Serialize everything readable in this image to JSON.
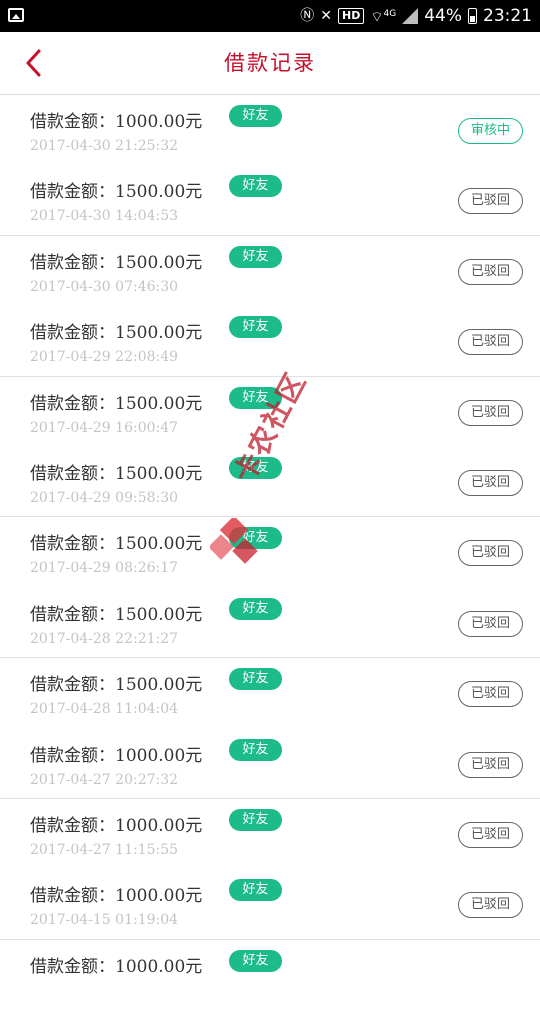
{
  "status_bar": {
    "battery": "44%",
    "time": "23:21",
    "hd_label": "HD",
    "network_label": "4G",
    "icons": [
      "gallery-icon",
      "nfc-icon",
      "mute-icon",
      "wifi-icon",
      "signal-icon",
      "battery-icon"
    ]
  },
  "header": {
    "title": "借款记录",
    "back_icon": "chevron-left-icon"
  },
  "colors": {
    "accent_red": "#c8102e",
    "tag_green": "#1dba8a",
    "time_gray": "#c4c4c4"
  },
  "records": [
    {
      "amount": "借款金额：1000.00元",
      "tag": "好友",
      "time": "2017-04-30 21:25:32",
      "status": "审核中",
      "status_type": "reviewing"
    },
    {
      "amount": "借款金额：1500.00元",
      "tag": "好友",
      "time": "2017-04-30 14:04:53",
      "status": "已驳回",
      "status_type": "rejected"
    },
    {
      "amount": "借款金额：1500.00元",
      "tag": "好友",
      "time": "2017-04-30 07:46:30",
      "status": "已驳回",
      "status_type": "rejected"
    },
    {
      "amount": "借款金额：1500.00元",
      "tag": "好友",
      "time": "2017-04-29 22:08:49",
      "status": "已驳回",
      "status_type": "rejected"
    },
    {
      "amount": "借款金额：1500.00元",
      "tag": "好友",
      "time": "2017-04-29 16:00:47",
      "status": "已驳回",
      "status_type": "rejected"
    },
    {
      "amount": "借款金额：1500.00元",
      "tag": "好友",
      "time": "2017-04-29 09:58:30",
      "status": "已驳回",
      "status_type": "rejected"
    },
    {
      "amount": "借款金额：1500.00元",
      "tag": "好友",
      "time": "2017-04-29 08:26:17",
      "status": "已驳回",
      "status_type": "rejected"
    },
    {
      "amount": "借款金额：1500.00元",
      "tag": "好友",
      "time": "2017-04-28 22:21:27",
      "status": "已驳回",
      "status_type": "rejected"
    },
    {
      "amount": "借款金额：1500.00元",
      "tag": "好友",
      "time": "2017-04-28 11:04:04",
      "status": "已驳回",
      "status_type": "rejected"
    },
    {
      "amount": "借款金额：1000.00元",
      "tag": "好友",
      "time": "2017-04-27 20:27:32",
      "status": "已驳回",
      "status_type": "rejected"
    },
    {
      "amount": "借款金额：1000.00元",
      "tag": "好友",
      "time": "2017-04-27 11:15:55",
      "status": "已驳回",
      "status_type": "rejected"
    },
    {
      "amount": "借款金额：1000.00元",
      "tag": "好友",
      "time": "2017-04-15 01:19:04",
      "status": "已驳回",
      "status_type": "rejected"
    },
    {
      "amount": "借款金额：1000.00元",
      "tag": "好友",
      "time": "",
      "status": "",
      "status_type": "rejected"
    }
  ],
  "watermark": {
    "text": "卡农社区"
  }
}
